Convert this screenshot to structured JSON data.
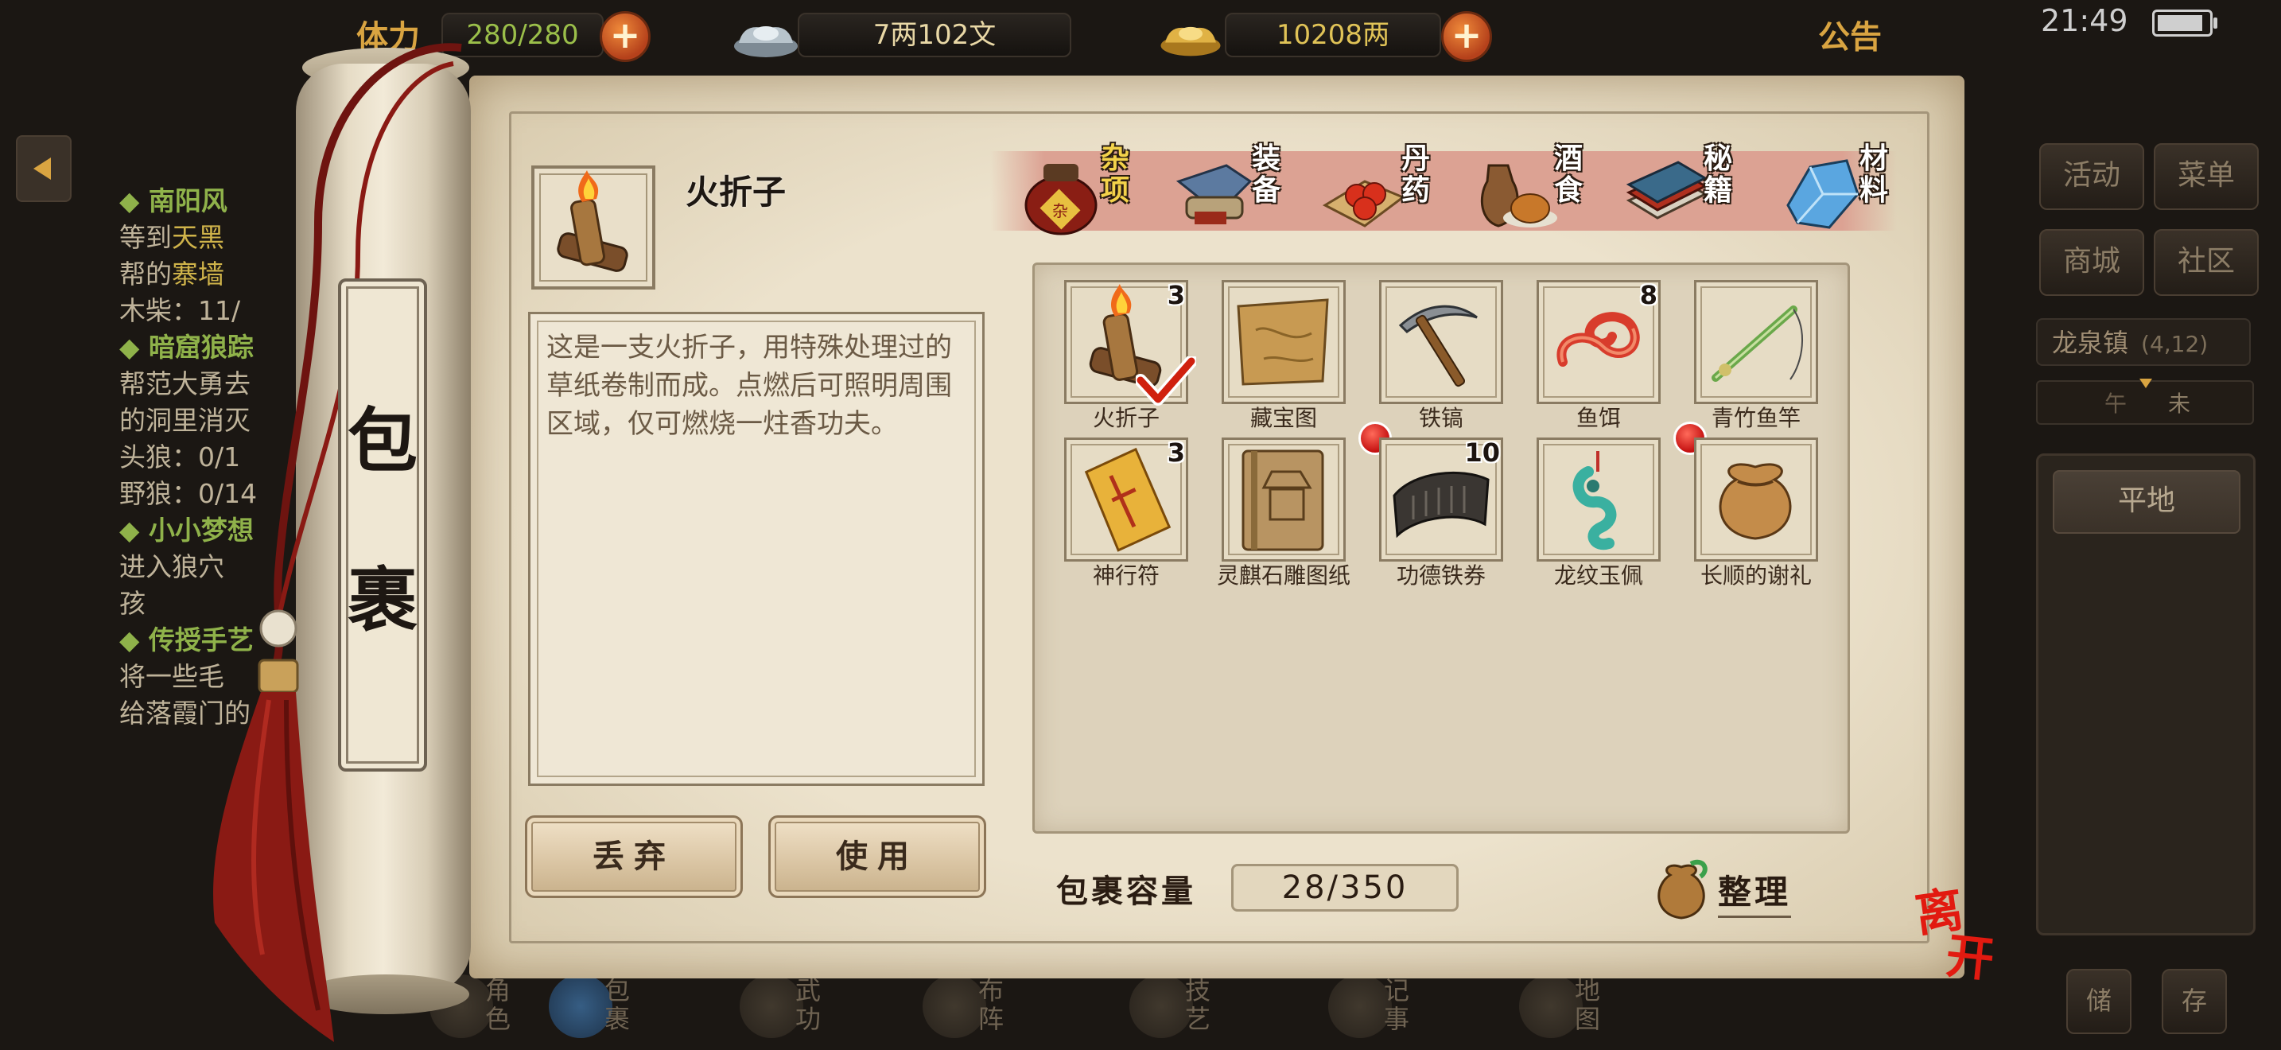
{
  "hud": {
    "stamina_label": "体力",
    "stamina": "280/280",
    "silver": "7两102文",
    "gold": "10208两",
    "notice": "公告",
    "time": "21:49"
  },
  "quest_log": [
    {
      "title": "南阳风",
      "lines": [
        [
          "等到",
          "天黑"
        ],
        [
          "帮的",
          "寨墙"
        ],
        [
          "木柴：11/",
          ""
        ]
      ]
    },
    {
      "title": "暗窟狼踪",
      "lines": [
        [
          "帮范大勇去",
          ""
        ],
        [
          "的洞里消灭",
          ""
        ],
        [
          "头狼：0/1",
          ""
        ],
        [
          "野狼：0/14",
          ""
        ]
      ]
    },
    {
      "title": "小小梦想",
      "lines": [
        [
          "进入狼穴",
          ""
        ],
        [
          "孩",
          ""
        ]
      ]
    },
    {
      "title": "传授手艺",
      "lines": [
        [
          "将一些毛",
          ""
        ],
        [
          "给落霞门的",
          ""
        ]
      ]
    }
  ],
  "side_panel": {
    "buttons": [
      "活动",
      "菜单",
      "商城",
      "社区"
    ],
    "town": "龙泉镇",
    "coord": "(4,12)",
    "compass_marks": [
      "午",
      "未"
    ],
    "terrain": "平地"
  },
  "bottom_nav": [
    "角色",
    "包裹",
    "武功",
    "布阵",
    "技艺",
    "记事",
    "地图"
  ],
  "bottom_right_buttons": [
    "储",
    "存"
  ],
  "bag": {
    "title_chars": [
      "包",
      "裹"
    ],
    "selected": {
      "name": "火折子",
      "description": "这是一支火折子，用特殊处理过的草纸卷制而成。点燃后可照明周围区域，仅可燃烧一炷香功夫。"
    },
    "actions": {
      "discard": "丢弃",
      "use": "使用"
    },
    "tabs": [
      {
        "label": "杂项",
        "icon": "wine-jar-icon",
        "active": true
      },
      {
        "label": "装备",
        "icon": "equipment-icon",
        "active": false
      },
      {
        "label": "丹药",
        "icon": "pill-icon",
        "active": false
      },
      {
        "label": "酒食",
        "icon": "food-icon",
        "active": false
      },
      {
        "label": "秘籍",
        "icon": "book-icon",
        "active": false
      },
      {
        "label": "材料",
        "icon": "crystal-icon",
        "active": false
      }
    ],
    "items": [
      {
        "name": "火折子",
        "count": "3",
        "icon": "torch-icon",
        "checked": true,
        "badge": false
      },
      {
        "name": "藏宝图",
        "count": "",
        "icon": "treasure-map-icon",
        "checked": false,
        "badge": false
      },
      {
        "name": "铁镐",
        "count": "",
        "icon": "pickaxe-icon",
        "checked": false,
        "badge": false
      },
      {
        "name": "鱼饵",
        "count": "8",
        "icon": "worm-icon",
        "checked": false,
        "badge": false
      },
      {
        "name": "青竹鱼竿",
        "count": "",
        "icon": "fishing-rod-icon",
        "checked": false,
        "badge": false
      },
      {
        "name": "神行符",
        "count": "3",
        "icon": "talisman-icon",
        "checked": false,
        "badge": false
      },
      {
        "name": "灵麒石雕图纸",
        "count": "",
        "icon": "blueprint-book-icon",
        "checked": false,
        "badge": false
      },
      {
        "name": "功德铁券",
        "count": "10",
        "icon": "iron-tablet-icon",
        "checked": false,
        "badge": true
      },
      {
        "name": "龙纹玉佩",
        "count": "",
        "icon": "jade-pendant-icon",
        "checked": false,
        "badge": false
      },
      {
        "name": "长顺的谢礼",
        "count": "",
        "icon": "gift-bag-icon",
        "checked": false,
        "badge": true
      }
    ],
    "capacity_label": "包裹容量",
    "capacity": "28/350",
    "sort_label": "整理",
    "leave_label": "离开"
  }
}
